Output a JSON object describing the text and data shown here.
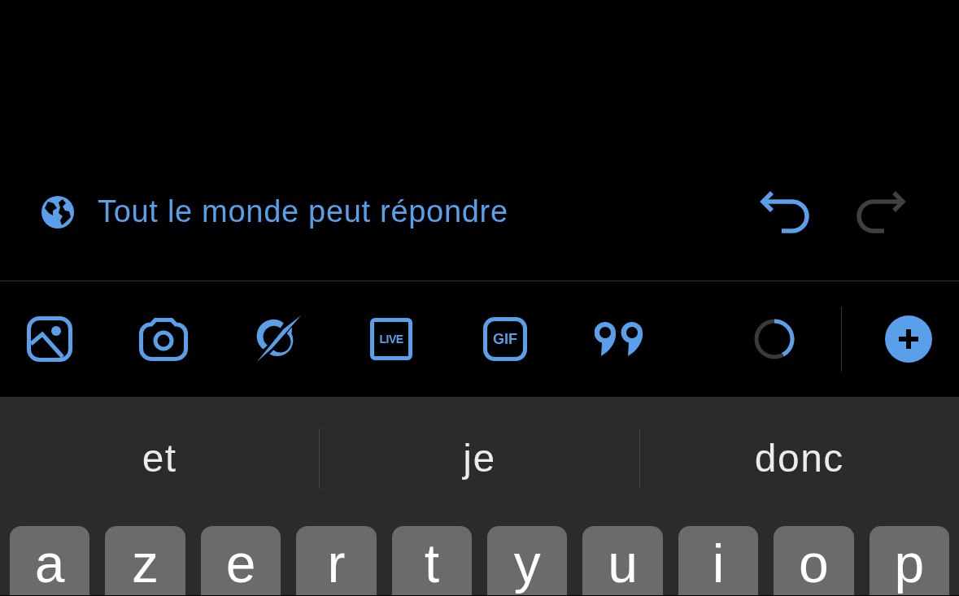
{
  "reply_setting": {
    "label": "Tout le monde peut répondre"
  },
  "history_buttons": [
    {
      "kind": "undo",
      "disabled": false
    },
    {
      "kind": "redo",
      "disabled": true
    }
  ],
  "toolbar": {
    "tools": [
      {
        "kind": "image"
      },
      {
        "kind": "camera"
      },
      {
        "kind": "spark"
      },
      {
        "kind": "square_label",
        "label": "LIVE"
      },
      {
        "kind": "rounded_label",
        "label": "GIF"
      },
      {
        "kind": "quote"
      }
    ],
    "counter": {
      "level": 0.42
    }
  },
  "keyboard": {
    "suggestions": [
      "et",
      "je",
      "donc"
    ],
    "keys": [
      "a",
      "z",
      "e",
      "r",
      "t",
      "y",
      "u",
      "i",
      "o",
      "p"
    ]
  }
}
